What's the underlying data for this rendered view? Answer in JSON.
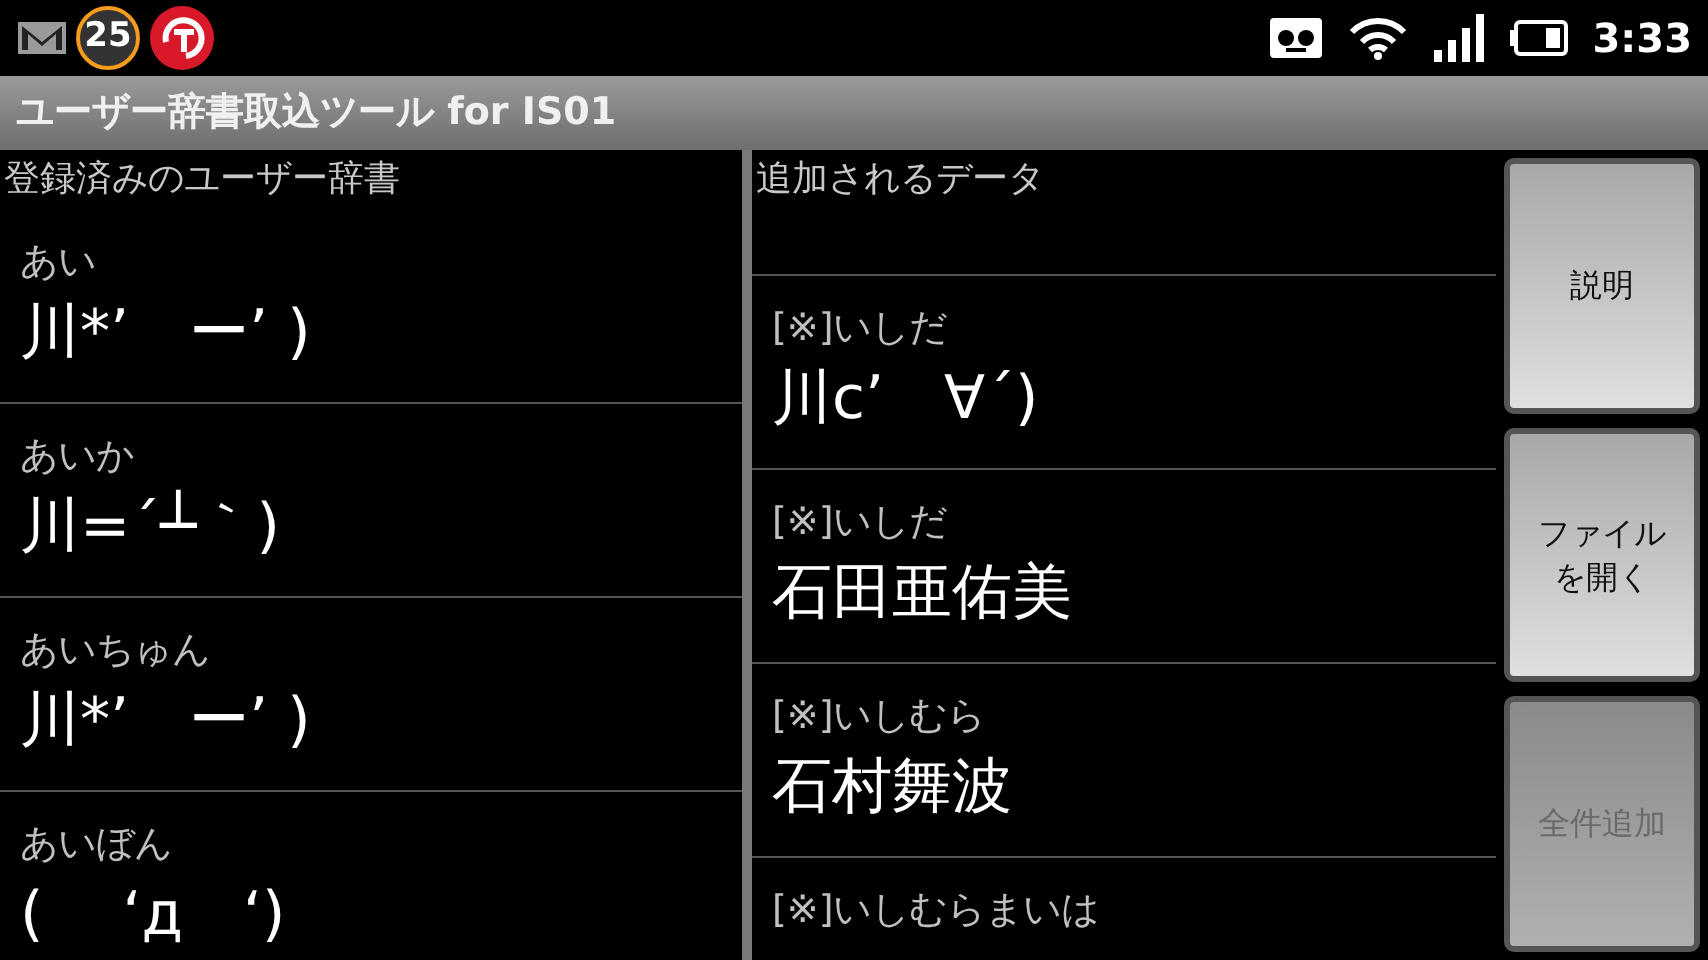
{
  "status_bar": {
    "notification_count": "25",
    "time": "3:33"
  },
  "window": {
    "title": "ユーザー辞書取込ツール for IS01"
  },
  "registered": {
    "heading": "登録済みのユーザー辞書",
    "items": [
      {
        "reading": "あい",
        "word": "川*’　ー’ )"
      },
      {
        "reading": "あいか",
        "word": "川=´┴｀)"
      },
      {
        "reading": "あいちゅん",
        "word": "川*’　ー’ )"
      },
      {
        "reading": "あいぼん",
        "word": "(　 ‘д　‘)"
      }
    ]
  },
  "incoming": {
    "heading": "追加されるデータ",
    "items": [
      {
        "reading": "[※]いしだ",
        "word": "川c’　∀´)"
      },
      {
        "reading": "[※]いしだ",
        "word": "石田亜佑美"
      },
      {
        "reading": "[※]いしむら",
        "word": "石村舞波"
      },
      {
        "reading": "[※]いしむらまいは"
      }
    ]
  },
  "buttons": [
    {
      "label": "説明",
      "disabled": false
    },
    {
      "label": "ファイルを開く",
      "disabled": false
    },
    {
      "label": "全件追加",
      "disabled": true
    }
  ]
}
